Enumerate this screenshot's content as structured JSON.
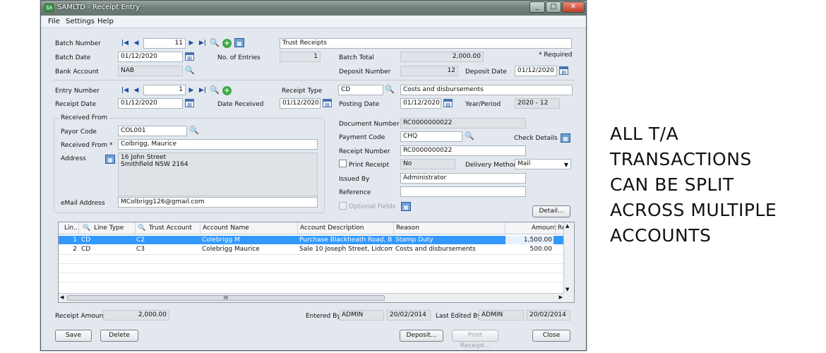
{
  "window": {
    "title": "SAMLTD - Receipt Entry",
    "icon_text": "SA"
  },
  "menu": [
    "File",
    "Settings",
    "Help"
  ],
  "batch": {
    "number_label": "Batch Number",
    "number": "11",
    "description": "Trust Receipts",
    "date_label": "Batch Date",
    "date": "01/12/2020",
    "entries_label": "No. of Entries",
    "entries": "1",
    "total_label": "Batch Total",
    "total": "2,000.00",
    "required_label": "* Required",
    "bank_label": "Bank Account",
    "bank": "NAB",
    "deposit_number_label": "Deposit Number",
    "deposit_number": "12",
    "deposit_date_label": "Deposit Date",
    "deposit_date": "01/12/2020"
  },
  "entry": {
    "number_label": "Entry Number",
    "number": "1",
    "receipt_type_label": "Receipt Type",
    "receipt_type": "CD",
    "receipt_type_desc": "Costs and disbursements",
    "receipt_date_label": "Receipt Date",
    "receipt_date": "01/12/2020",
    "date_received_label": "Date Received",
    "date_received": "01/12/2020",
    "posting_date_label": "Posting Date",
    "posting_date": "01/12/2020",
    "year_period_label": "Year/Period",
    "year_period": "2020 - 12"
  },
  "received_from": {
    "group_label": "Received From",
    "payor_code_label": "Payor Code",
    "payor_code": "COL001",
    "received_from_label": "Received From *",
    "received_from": "Colbrigg, Maurice",
    "address_label": "Address",
    "address_line1": "16 John Street",
    "address_line2": "Smithfield NSW 2164",
    "email_label": "eMail Address",
    "email": "MColbrigg126@gmail.com"
  },
  "document": {
    "doc_number_label": "Document Number",
    "doc_number": "RC0000000022",
    "payment_code_label": "Payment Code",
    "payment_code": "CHQ",
    "check_details_label": "Check Details",
    "receipt_number_label": "Receipt Number",
    "receipt_number": "RC0000000022",
    "print_receipt_label": "Print Receipt",
    "print_receipt": "No",
    "delivery_method_label": "Delivery Method",
    "delivery_method": "Mail",
    "issued_by_label": "Issued By",
    "issued_by": "Administrator",
    "reference_label": "Reference",
    "reference": "",
    "optional_fields_label": "Optional Fields",
    "detail_button": "Detail..."
  },
  "grid": {
    "headers": [
      "Lin...",
      "Line Type",
      "Trust Account",
      "Account Name",
      "Account Description",
      "Reason",
      "Amount",
      "Re"
    ],
    "rows": [
      [
        "1",
        "CD",
        "C2",
        "Colebrigg M",
        "Purchase Blackheath Road, Bla...",
        "Stamp Duty",
        "1,500.00"
      ],
      [
        "2",
        "CD",
        "C3",
        "Colebrigg Maurice",
        "Sale 10 Joseph Street, Lidcombe",
        "Costs and disbursements",
        "500.00"
      ]
    ],
    "scroll_thumb": "III"
  },
  "footer": {
    "receipt_amount_label": "Receipt Amount",
    "receipt_amount": "2,000.00",
    "entered_by_label": "Entered By:",
    "entered_by": "ADMIN",
    "entered_date": "20/02/2014",
    "last_edited_label": "Last Edited By:",
    "last_edited_by": "ADMIN",
    "last_edited_date": "20/02/2014"
  },
  "buttons": {
    "save": "Save",
    "delete": "Delete",
    "deposit": "Deposit...",
    "print_receipt": "Print Receipt...",
    "close": "Close"
  },
  "side_caption": {
    "line1": "ALL T/A",
    "line2": "TRANSACTIONS",
    "line3": "CAN BE SPLIT",
    "line4": "ACROSS MULTIPLE",
    "line5": "ACCOUNTS"
  },
  "colors": {
    "selection": "#3399ff",
    "title_bar": "#6f8279",
    "window_bg": "#e3e8ee"
  },
  "icons": {
    "nav_first": "first-icon",
    "nav_prev": "prev-icon",
    "nav_next": "next-icon",
    "nav_last": "last-icon",
    "zoom": "magnifier-icon",
    "new": "plus-icon",
    "calendar": "calendar-icon",
    "finder": "finder-icon"
  }
}
